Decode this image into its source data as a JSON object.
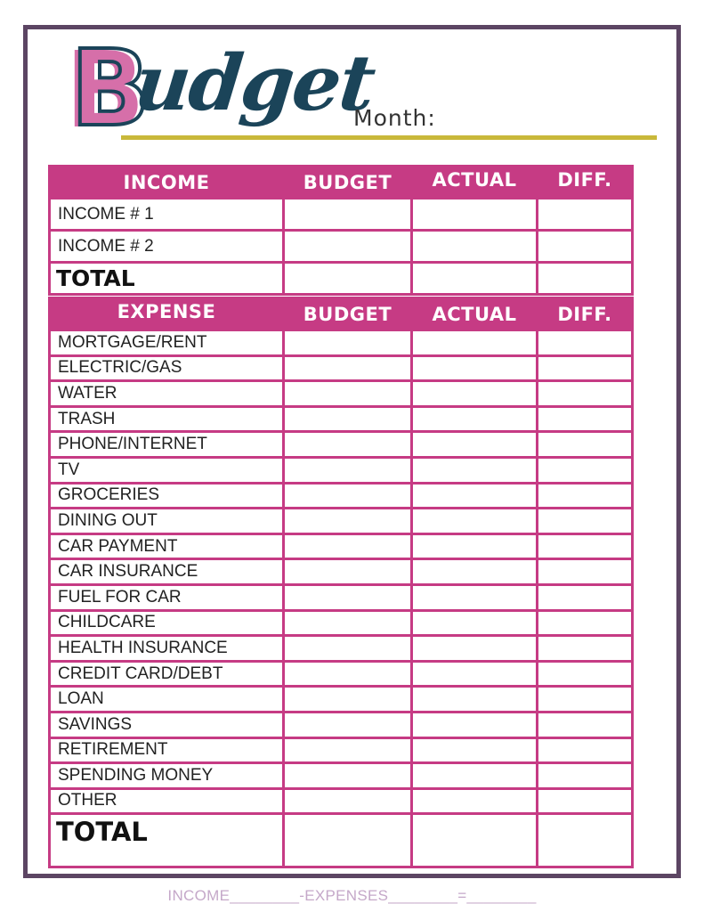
{
  "header": {
    "title_initial": "B",
    "title_rest": "udget",
    "month_label": "Month:"
  },
  "income_table": {
    "columns": [
      "INCOME",
      "BUDGET",
      "ACTUAL",
      "DIFF."
    ],
    "rows": [
      {
        "label": "INCOME # 1",
        "budget": "",
        "actual": "",
        "diff": ""
      },
      {
        "label": "INCOME # 2",
        "budget": "",
        "actual": "",
        "diff": ""
      }
    ],
    "total_label": "TOTAL"
  },
  "expense_table": {
    "columns": [
      "EXPENSE",
      "BUDGET",
      "ACTUAL",
      "DIFF."
    ],
    "rows": [
      {
        "label": "MORTGAGE/RENT"
      },
      {
        "label": "ELECTRIC/GAS"
      },
      {
        "label": "WATER"
      },
      {
        "label": "TRASH"
      },
      {
        "label": "PHONE/INTERNET"
      },
      {
        "label": "TV"
      },
      {
        "label": "GROCERIES"
      },
      {
        "label": "DINING OUT"
      },
      {
        "label": "CAR PAYMENT"
      },
      {
        "label": "CAR INSURANCE"
      },
      {
        "label": "FUEL FOR CAR"
      },
      {
        "label": "CHILDCARE"
      },
      {
        "label": "HEALTH INSURANCE"
      },
      {
        "label": "CREDIT CARD/DEBT"
      },
      {
        "label": "LOAN"
      },
      {
        "label": "SAVINGS"
      },
      {
        "label": "RETIREMENT"
      },
      {
        "label": "SPENDING MONEY"
      },
      {
        "label": "OTHER"
      }
    ],
    "total_label": "TOTAL"
  },
  "footer": {
    "formula": "INCOME________-EXPENSES________=________"
  },
  "colors": {
    "accent_pink": "#c63b84",
    "logo_pink": "#d66fa9",
    "navy": "#1b4459",
    "frame_purple": "#5c4563",
    "underline_gold": "#c9b83a",
    "footer_text": "#c5a8c9"
  }
}
